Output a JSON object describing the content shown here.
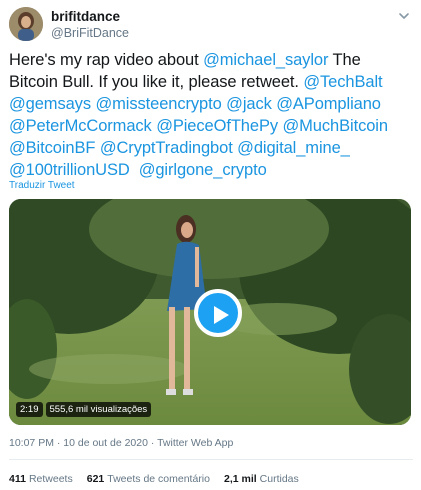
{
  "author": {
    "display_name": "brifitdance",
    "handle": "@BriFitDance"
  },
  "tweet": {
    "segments": [
      {
        "text": "Here's my rap video about ",
        "type": "text"
      },
      {
        "text": "@michael_saylor",
        "type": "mention"
      },
      {
        "text": " The Bitcoin Bull. If you like it, please retweet. ",
        "type": "text"
      },
      {
        "text": "@TechBalt",
        "type": "mention"
      },
      {
        "text": " ",
        "type": "text"
      },
      {
        "text": "@gemsays",
        "type": "mention"
      },
      {
        "text": " ",
        "type": "text"
      },
      {
        "text": "@missteencrypto",
        "type": "mention"
      },
      {
        "text": " ",
        "type": "text"
      },
      {
        "text": "@jack",
        "type": "mention"
      },
      {
        "text": " ",
        "type": "text"
      },
      {
        "text": "@APompliano",
        "type": "mention"
      },
      {
        "text": " ",
        "type": "text"
      },
      {
        "text": "@PeterMcCormack",
        "type": "mention"
      },
      {
        "text": " ",
        "type": "text"
      },
      {
        "text": "@PieceOfThePy",
        "type": "mention"
      },
      {
        "text": " ",
        "type": "text"
      },
      {
        "text": "@MuchBitcoin",
        "type": "mention"
      },
      {
        "text": " ",
        "type": "text"
      },
      {
        "text": "@BitcoinBF",
        "type": "mention"
      },
      {
        "text": " ",
        "type": "text"
      },
      {
        "text": "@CryptTradingbot",
        "type": "mention"
      },
      {
        "text": " ",
        "type": "text"
      },
      {
        "text": "@digital_mine_",
        "type": "mention"
      },
      {
        "text": " ",
        "type": "text"
      },
      {
        "text": "@100trillionUSD",
        "type": "mention"
      },
      {
        "text": "  ",
        "type": "text"
      },
      {
        "text": "@girlgone_crypto",
        "type": "mention"
      }
    ],
    "translate_label": "Traduzir Tweet"
  },
  "video": {
    "duration": "2:19",
    "views": "555,6 mil visualizações"
  },
  "meta": {
    "timestamp": "10:07 PM · 10 de out de 2020 · Twitter Web App"
  },
  "stats": {
    "retweets_count": "411",
    "retweets_label": "Retweets",
    "comments_count": "621",
    "comments_label": "Tweets de comentário",
    "likes_count": "2,1 mil",
    "likes_label": "Curtidas"
  },
  "colors": {
    "link": "#1b95e0",
    "play_button": "#1da1f2",
    "muted_text": "#657786"
  },
  "icons": {
    "menu": "chevron-down-icon",
    "play": "play-icon"
  }
}
